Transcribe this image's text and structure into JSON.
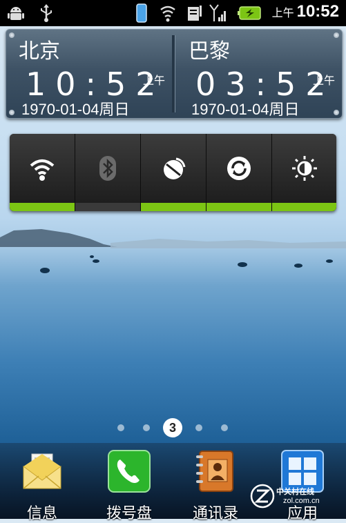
{
  "status_bar": {
    "icons": [
      "android-icon",
      "usb-icon",
      "phone-icon",
      "wifi-icon",
      "sim-icon",
      "signal-icon",
      "battery-icon"
    ],
    "ampm": "上午",
    "time": "10:52"
  },
  "clock_widget": {
    "left": {
      "city": "北京",
      "time": "10:52",
      "ampm": "上午",
      "date": "1970-01-04周日"
    },
    "right": {
      "city": "巴黎",
      "time": "03:52",
      "ampm": "上午",
      "date": "1970-01-04周日"
    }
  },
  "power_widget": {
    "buttons": [
      {
        "name": "wifi",
        "on": true
      },
      {
        "name": "bluetooth",
        "on": false
      },
      {
        "name": "gps",
        "on": true
      },
      {
        "name": "sync",
        "on": true
      },
      {
        "name": "brightness",
        "on": true
      }
    ],
    "colors": {
      "on": "#7cc514",
      "off": "#3a3a3a"
    }
  },
  "pager": {
    "current": "3"
  },
  "dock": {
    "apps": [
      {
        "label": "信息",
        "icon": "messages-envelope-icon"
      },
      {
        "label": "拨号盘",
        "icon": "phone-dialer-icon"
      },
      {
        "label": "通讯录",
        "icon": "contacts-book-icon"
      },
      {
        "label": "应用",
        "icon": "apps-grid-icon"
      }
    ]
  },
  "watermark": {
    "line1": "中关村在线",
    "line2": "zol.com.cn"
  }
}
